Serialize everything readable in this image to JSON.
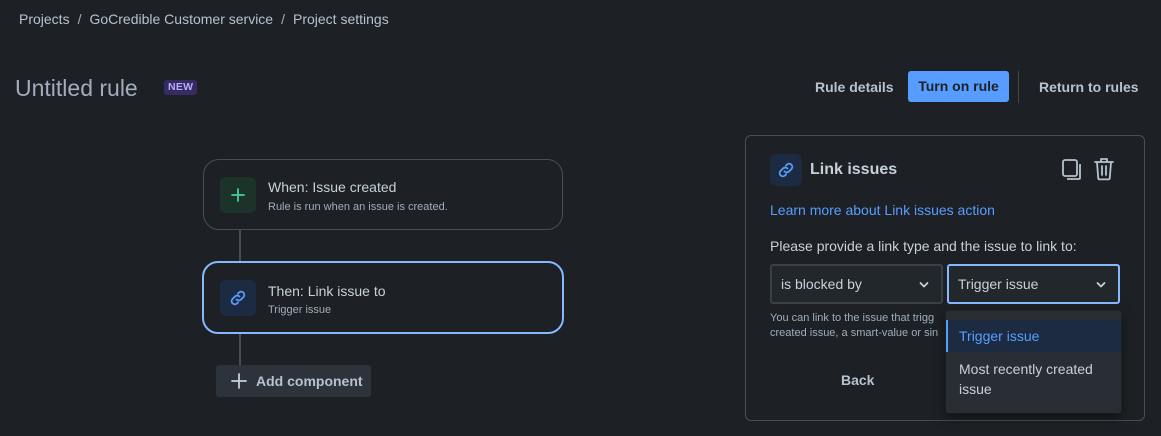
{
  "breadcrumb": [
    "Projects",
    "GoCredible Customer service",
    "Project settings"
  ],
  "header": {
    "title": "Untitled rule",
    "badge": "NEW",
    "rule_details": "Rule details",
    "turn_on": "Turn on rule",
    "return": "Return to rules"
  },
  "flow": {
    "trigger": {
      "title": "When: Issue created",
      "subtitle": "Rule is run when an issue is created.",
      "icon": "plus-icon"
    },
    "action": {
      "title": "Then: Link issue to",
      "subtitle": "Trigger issue",
      "icon": "link-icon"
    },
    "add_component": "Add component"
  },
  "panel": {
    "title": "Link issues",
    "learn_more": "Learn more about Link issues action",
    "instruction": "Please provide a link type and the issue to link to:",
    "link_type": "is blocked by",
    "issue_select": "Trigger issue",
    "helper_line1": "You can link to the issue that trigg",
    "helper_line2": "created issue, a smart-value or sin",
    "back": "Back"
  },
  "menu": {
    "options": [
      "Trigger issue",
      "Most recently created issue"
    ],
    "selected": "Trigger issue"
  },
  "colors": {
    "background": "#1d2125",
    "accent": "#579dff",
    "selected_border": "#85b8ff"
  }
}
